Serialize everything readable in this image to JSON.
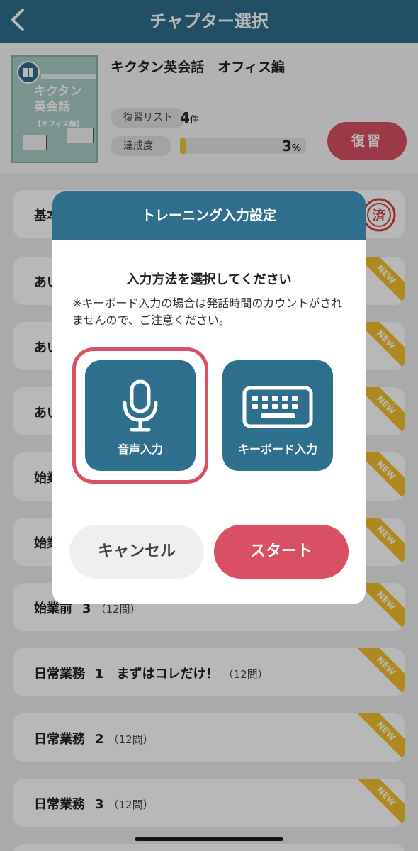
{
  "header": {
    "title": "チャプター選択"
  },
  "book": {
    "title": "キクタン英会話　オフィス編",
    "cover_title": "キクタン\n英会話\n【オフィス編】",
    "review_list_label": "復習リスト",
    "review_count": "4",
    "review_count_unit": "件",
    "achievement_label": "達成度",
    "achievement_value": "3",
    "achievement_unit": "%",
    "achievement_fraction": 0.03,
    "review_button": "復習"
  },
  "chapters": [
    {
      "title": "基本",
      "num": "",
      "q": "",
      "badge": "done"
    },
    {
      "title": "あい",
      "num": "",
      "q": "",
      "badge": "new"
    },
    {
      "title": "あい",
      "num": "",
      "q": "",
      "badge": "new"
    },
    {
      "title": "あい",
      "num": "",
      "q": "",
      "badge": "new"
    },
    {
      "title": "始業",
      "num": "",
      "q": "",
      "badge": "new"
    },
    {
      "title": "始業",
      "num": "",
      "q": "",
      "badge": "new"
    },
    {
      "title": "始業前",
      "num": "3",
      "q": "（12問）",
      "badge": "new"
    },
    {
      "title": "日常業務",
      "num": "1　まずはコレだけ！",
      "q": "（12問）",
      "badge": "new"
    },
    {
      "title": "日常業務",
      "num": "2",
      "q": "（12問）",
      "badge": "new"
    },
    {
      "title": "日常業務",
      "num": "3",
      "q": "（12問）",
      "badge": "new"
    }
  ],
  "new_badge": "NEW",
  "done_badge": "済",
  "dialog": {
    "title": "トレーニング入力設定",
    "prompt": "入力方法を選択してください",
    "note": "※キーボード入力の場合は発話時間のカウントがされませんので、ご注意ください。",
    "voice_label": "音声入力",
    "keyboard_label": "キーボード入力",
    "selected": "voice",
    "cancel": "キャンセル",
    "start": "スタート"
  },
  "colors": {
    "primary": "#2e6f8e",
    "accent": "#d85062",
    "new": "#f3be2c"
  }
}
